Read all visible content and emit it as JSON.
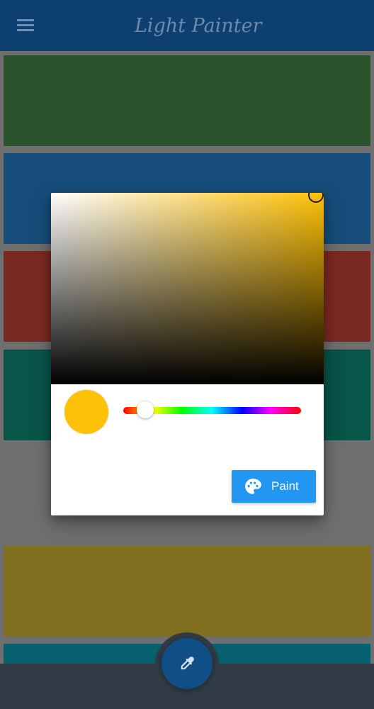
{
  "app": {
    "title": "Light Painter"
  },
  "colors": {
    "topbar": "#0d3f70",
    "selected": "#ffc107",
    "paint_button": "#2196f3",
    "bottom_bar": "#303b45",
    "swatches": [
      "#2a552c",
      "#164d7b",
      "#7b2a22",
      "#08554a",
      "#707070",
      "#7f6f1e",
      "#07606e"
    ]
  },
  "icons": {
    "menu": "menu-icon",
    "picker": "eyedropper-icon",
    "paint": "palette-icon"
  },
  "dialog": {
    "hue_value": 0.13,
    "paint_label": "Paint"
  }
}
